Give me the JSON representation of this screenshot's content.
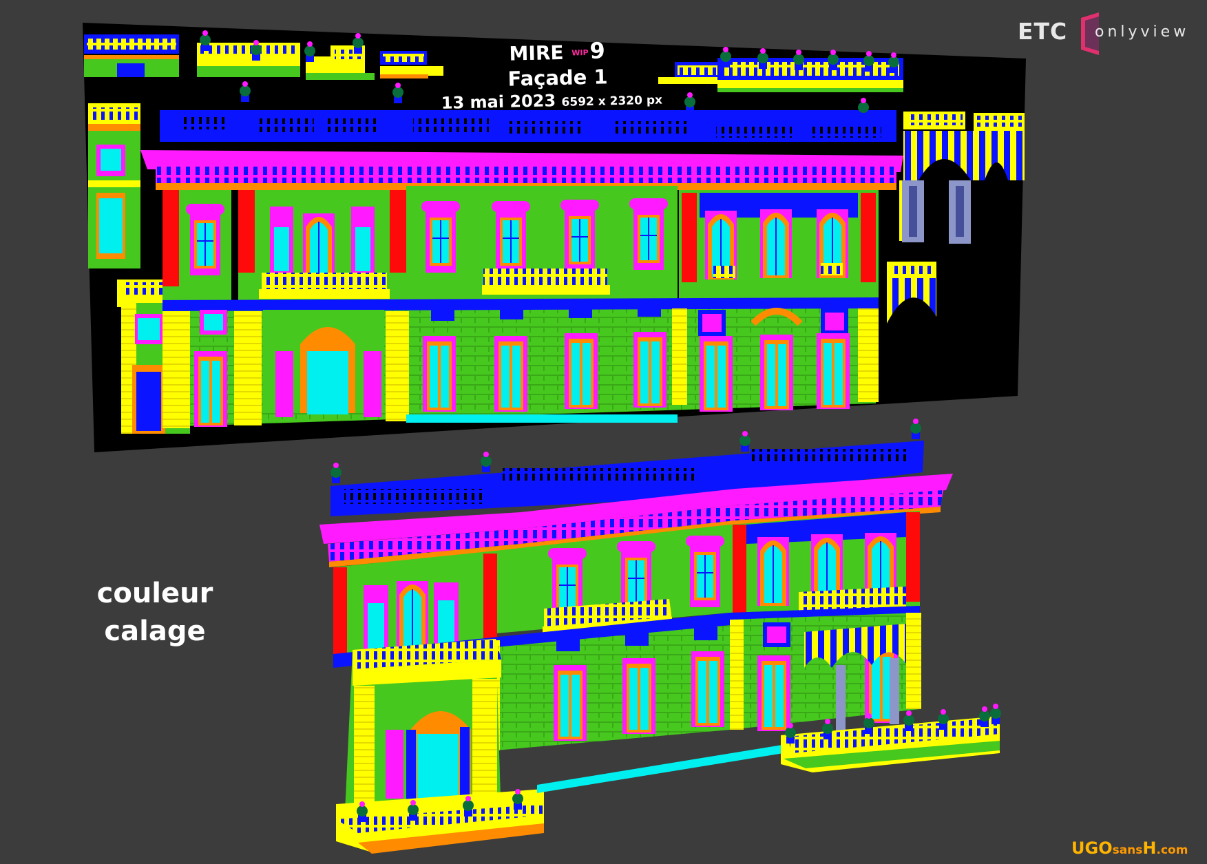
{
  "brand": {
    "left": "ETC",
    "right": "onlyview"
  },
  "mire": {
    "title": "MIRE",
    "wip": "WIP",
    "number": "9",
    "facade": "Façade 1",
    "date": "13 mai 2023",
    "resolution": "6592 x 2320 px"
  },
  "caption": {
    "line1": "couleur",
    "line2": "calage"
  },
  "watermark": {
    "part1": "UGO",
    "part2": "sans",
    "part3": "H",
    "part4": ".com"
  },
  "colors": {
    "background": "#3c3c3c",
    "panel": "#000000",
    "blue": "#0a14ff",
    "magenta": "#ff1aff",
    "green": "#46c81e",
    "yellow": "#ffff00",
    "orange": "#ff8c00",
    "cyan": "#00f0f0",
    "red": "#ff0a0a",
    "brand_accent": "#e0306e"
  }
}
